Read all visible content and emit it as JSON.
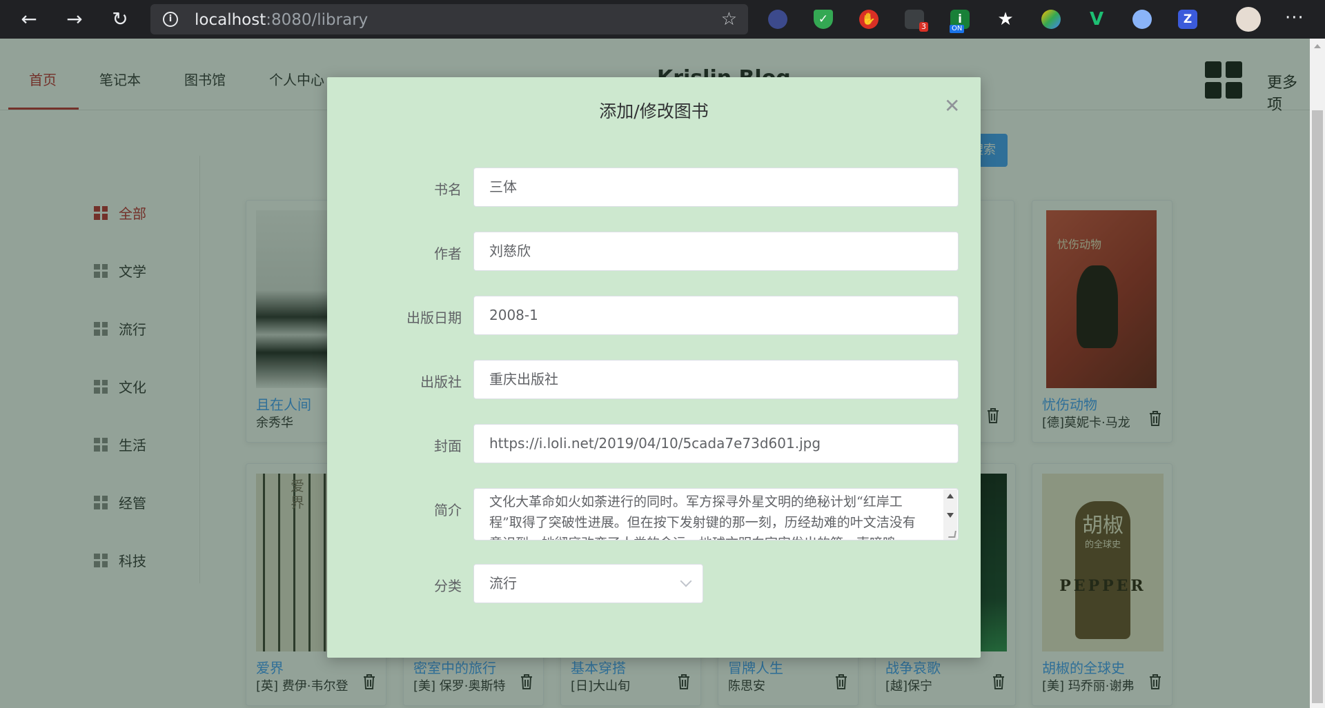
{
  "browser": {
    "url_host": "localhost",
    "url_rest": ":8080/library",
    "ext_badge": "3",
    "ext_on": "ON",
    "ext_z": "Z"
  },
  "nav": {
    "items": [
      "首页",
      "笔记本",
      "图书馆",
      "个人中心"
    ],
    "brand": "Krislin Blog",
    "more": "更多项"
  },
  "sidebar": {
    "categories": [
      "全部",
      "文学",
      "流行",
      "文化",
      "生活",
      "经管",
      "科技"
    ]
  },
  "search_button": "搜索",
  "books_row1": [
    {
      "title": "且在人间",
      "author": "余秀华"
    },
    {
      "title": "忧伤动物",
      "author": "[德]莫妮卡·马龙"
    }
  ],
  "books_row2": [
    {
      "title": "爱界",
      "author": "[英] 费伊·韦尔登"
    },
    {
      "title": "密室中的旅行",
      "author": "[美] 保罗·奥斯特"
    },
    {
      "title": "基本穿搭",
      "author": "[日]大山旬"
    },
    {
      "title": "冒牌人生",
      "author": "陈思安"
    },
    {
      "title": "战争哀歌",
      "author": "[越]保宁"
    },
    {
      "title": "胡椒的全球史",
      "author": "[美] 玛乔丽·谢弗"
    }
  ],
  "covers": {
    "aijie_text": "爱界",
    "hujiao_title": "胡椒",
    "hujiao_sub": "的全球史",
    "pepper": "PEPPER",
    "youshang": "忧伤动物"
  },
  "dialog": {
    "title": "添加/修改图书",
    "fields": {
      "name_label": "书名",
      "name_value": "三体",
      "author_label": "作者",
      "author_value": "刘慈欣",
      "date_label": "出版日期",
      "date_value": "2008-1",
      "publisher_label": "出版社",
      "publisher_value": "重庆出版社",
      "cover_label": "封面",
      "cover_value": "https://i.loli.net/2019/04/10/5cada7e73d601.jpg",
      "intro_label": "简介",
      "intro_value": "文化大革命如火如荼进行的同时。军方探寻外星文明的绝秘计划“红岸工程”取得了突破性进展。但在按下发射键的那一刻，历经劫难的叶文洁没有意识到，她彻底改变了人类的命运。地球文明向宇宙发出的第一声啼鸣。",
      "category_label": "分类",
      "category_value": "流行"
    }
  },
  "colors": {
    "accent": "#c1282d",
    "link": "#409eff",
    "dialog_bg": "#cde8cf"
  }
}
